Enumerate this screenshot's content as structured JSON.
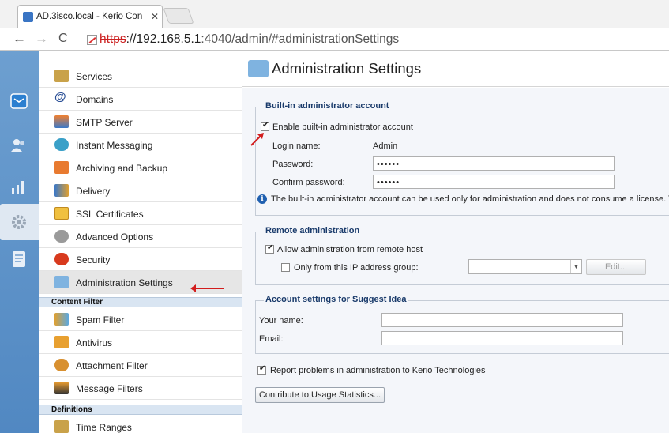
{
  "browser": {
    "tab_title": "AD.3isco.local - Kerio Con",
    "tab_close": "✕",
    "url_scheme": "https",
    "url_host": "://192.168.5.1",
    "url_rest": ":4040/admin/#administrationSettings"
  },
  "sidebar": {
    "items": [
      {
        "label": "Services",
        "icon": "services-icon"
      },
      {
        "label": "Domains",
        "icon": "at-sign-icon"
      },
      {
        "label": "SMTP Server",
        "icon": "smtp-server-icon"
      },
      {
        "label": "Instant Messaging",
        "icon": "instant-messaging-icon"
      },
      {
        "label": "Archiving and Backup",
        "icon": "archive-icon"
      },
      {
        "label": "Delivery",
        "icon": "delivery-icon"
      },
      {
        "label": "SSL Certificates",
        "icon": "certificate-icon"
      },
      {
        "label": "Advanced Options",
        "icon": "advanced-gears-icon"
      },
      {
        "label": "Security",
        "icon": "security-icon"
      },
      {
        "label": "Administration Settings",
        "icon": "admin-settings-icon"
      }
    ],
    "section_content_filter": "Content Filter",
    "content_filter_items": [
      {
        "label": "Spam Filter",
        "icon": "spam-filter-icon"
      },
      {
        "label": "Antivirus",
        "icon": "antivirus-icon"
      },
      {
        "label": "Attachment Filter",
        "icon": "attachment-filter-icon"
      },
      {
        "label": "Message Filters",
        "icon": "message-filters-icon"
      }
    ],
    "section_definitions": "Definitions",
    "definitions_items": [
      {
        "label": "Time Ranges",
        "icon": "time-ranges-icon"
      }
    ]
  },
  "main": {
    "title": "Administration Settings",
    "builtin": {
      "legend": "Built-in administrator account",
      "enable_label": "Enable built-in administrator account",
      "enable_checked": true,
      "login_label": "Login name:",
      "login_value": "Admin",
      "password_label": "Password:",
      "password_value": "••••••",
      "confirm_label": "Confirm password:",
      "confirm_value": "••••••",
      "info_text": "The built-in administrator account can be used only for administration and does not consume a license. Th"
    },
    "remote": {
      "legend": "Remote administration",
      "allow_label": "Allow administration from remote host",
      "allow_checked": true,
      "only_label": "Only from this IP address group:",
      "only_checked": false,
      "group_value": "",
      "edit_button": "Edit..."
    },
    "suggest": {
      "legend": "Account settings for Suggest Idea",
      "name_label": "Your name:",
      "name_value": "",
      "email_label": "Email:",
      "email_value": ""
    },
    "report_label": "Report problems in administration to Kerio Technologies",
    "report_checked": true,
    "contribute_button": "Contribute to Usage Statistics..."
  },
  "colors": {
    "icon_strip": "#5b8fc7",
    "section_header": "#d9e5f2",
    "legend_text": "#1a3b6b",
    "annotation_arrow": "#d21d1d"
  }
}
